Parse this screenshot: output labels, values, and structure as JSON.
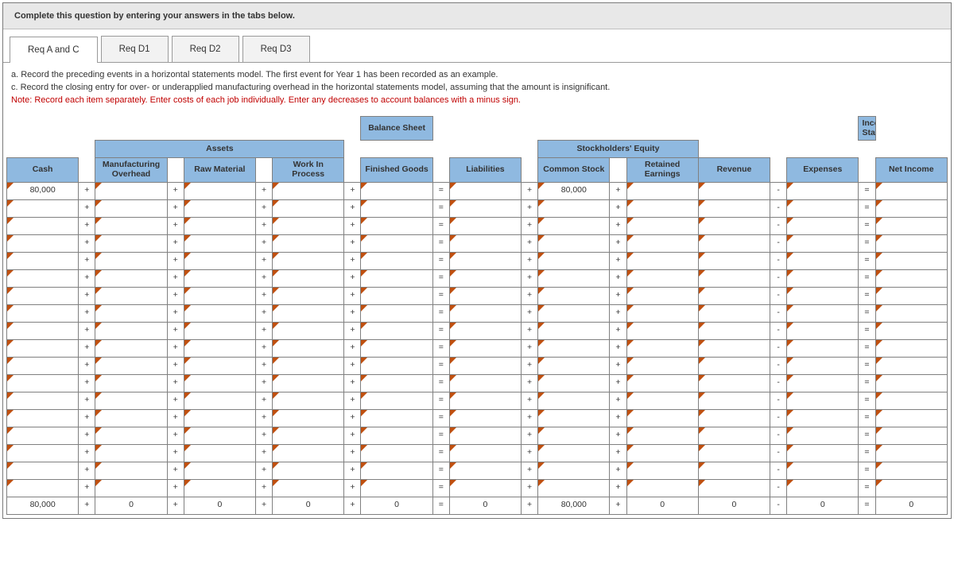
{
  "instruction": "Complete this question by entering your answers in the tabs below.",
  "tabs": [
    {
      "label": "Req A and C",
      "active": true
    },
    {
      "label": "Req D1",
      "active": false
    },
    {
      "label": "Req D2",
      "active": false
    },
    {
      "label": "Req D3",
      "active": false
    }
  ],
  "body_lines": {
    "a": "a. Record the preceding events in a horizontal statements model. The first event for Year 1 has been recorded as an example.",
    "c": "c. Record the closing entry for over- or underapplied manufacturing overhead in the horizontal statements model, assuming that the amount is insignificant.",
    "note": "Note: Record each item separately. Enter costs of each job individually. Enter any decreases to account balances with a minus sign."
  },
  "headers": {
    "balance_sheet": "Balance Sheet",
    "income_statement": "Income Statement",
    "assets": "Assets",
    "stockholders_equity": "Stockholders' Equity",
    "cash": "Cash",
    "manuf_overhead": "Manufacturing Overhead",
    "raw_material": "Raw Material",
    "wip": "Work In Process",
    "finished_goods": "Finished Goods",
    "liabilities": "Liabilities",
    "common_stock": "Common Stock",
    "retained_earnings": "Retained Earnings",
    "revenue": "Revenue",
    "expenses": "Expenses",
    "net_income": "Net Income"
  },
  "ops": {
    "plus": "+",
    "equals": "=",
    "minus": "-"
  },
  "first_row": {
    "cash": "80,000",
    "common_stock": "80,000"
  },
  "blank_rows_count": 17,
  "totals_row": {
    "cash": "80,000",
    "manuf_overhead": "0",
    "raw_material": "0",
    "wip": "0",
    "finished_goods": "0",
    "liabilities": "0",
    "common_stock": "80,000",
    "retained_earnings": "0",
    "revenue": "0",
    "expenses": "0",
    "net_income": "0"
  }
}
